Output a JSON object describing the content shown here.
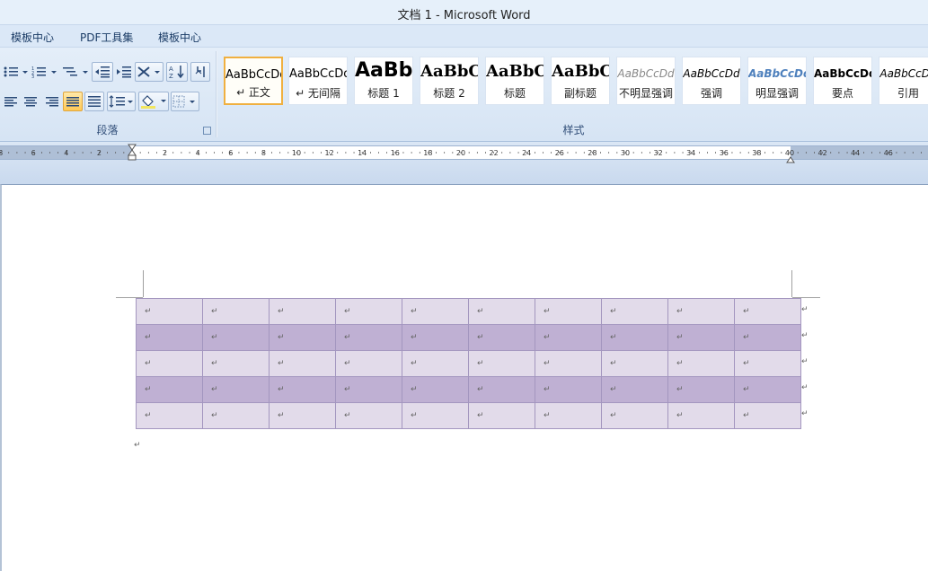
{
  "window": {
    "title": "文档 1 - Microsoft Word"
  },
  "menubar": {
    "items": [
      "模板中心",
      "PDF工具集",
      "模板中心"
    ]
  },
  "ribbon": {
    "paragraph_group_label": "段落",
    "styles_group_label": "样式",
    "styles": [
      {
        "sample": "AaBbCcDd",
        "name": "↵ 正文",
        "selected": true
      },
      {
        "sample": "AaBbCcDd",
        "name": "↵ 无间隔"
      },
      {
        "sample": "AaBb",
        "name": "标题 1"
      },
      {
        "sample": "AaBbC",
        "name": "标题 2"
      },
      {
        "sample": "AaBbC",
        "name": "标题"
      },
      {
        "sample": "AaBbC",
        "name": "副标题"
      },
      {
        "sample": "AaBbCcDd",
        "name": "不明显强调"
      },
      {
        "sample": "AaBbCcDd",
        "name": "强调"
      },
      {
        "sample": "AaBbCcDd",
        "name": "明显强调"
      },
      {
        "sample": "AaBbCcDd",
        "name": "要点"
      },
      {
        "sample": "AaBbCcDd",
        "name": "引用"
      }
    ]
  },
  "ruler": {
    "left_labels": [
      "8",
      "6",
      "4",
      "2"
    ],
    "right_labels": [
      "2",
      "4",
      "6",
      "8",
      "10",
      "12",
      "14",
      "16",
      "18",
      "20",
      "22",
      "24",
      "26",
      "28",
      "30",
      "32",
      "34",
      "36",
      "38",
      "40",
      "42",
      "44",
      "46"
    ]
  },
  "document": {
    "table": {
      "rows": 5,
      "cols": 10,
      "cell_mark": "↵",
      "row_shading": [
        "light",
        "dark",
        "light",
        "dark",
        "light"
      ],
      "colors": {
        "light": "#e2dbea",
        "dark": "#bfb0d3",
        "border": "#a396bf"
      }
    },
    "paragraph_mark": "↵"
  }
}
